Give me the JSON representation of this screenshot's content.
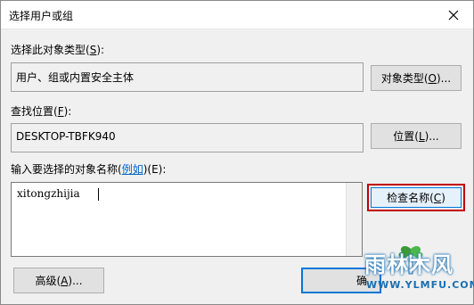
{
  "window": {
    "title": "选择用户或组"
  },
  "object_type": {
    "label_prefix": "选择此对象类型(",
    "label_key": "S",
    "label_suffix": "):",
    "value": "用户、组或内置安全主体",
    "button_prefix": "对象类型(",
    "button_key": "O",
    "button_suffix": ")..."
  },
  "location": {
    "label_prefix": "查找位置(",
    "label_key": "F",
    "label_suffix": "):",
    "value": "DESKTOP-TBFK940",
    "button_prefix": "位置(",
    "button_key": "L",
    "button_suffix": ")..."
  },
  "names": {
    "label_prefix": "输入要选择的对象名称(",
    "label_link": "例如",
    "label_suffix": ")(E):",
    "value": "xitongzhijia",
    "check_prefix": "检查名称(",
    "check_key": "C",
    "check_suffix": ")"
  },
  "footer": {
    "advanced_prefix": "高级(",
    "advanced_key": "A",
    "advanced_suffix": ")...",
    "ok_label": "确"
  },
  "watermark": {
    "name": "雨林木风",
    "url": "WWW.YLMFU.COM"
  }
}
